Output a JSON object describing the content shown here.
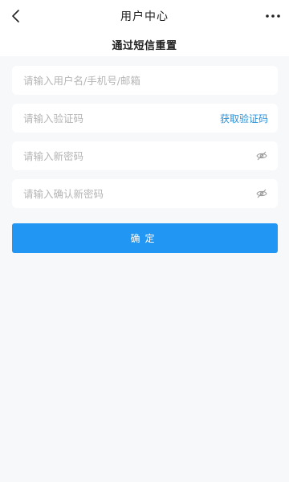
{
  "navbar": {
    "title": "用户中心",
    "back_icon": "chevron-left-icon",
    "more_icon": "more-horizontal-icon"
  },
  "subheader": {
    "title": "通过短信重置"
  },
  "form": {
    "username_placeholder": "请输入用户名/手机号/邮箱",
    "code_placeholder": "请输入验证码",
    "get_code_label": "获取验证码",
    "new_password_placeholder": "请输入新密码",
    "confirm_password_placeholder": "请输入确认新密码",
    "eye_icon": "eye-off-icon"
  },
  "confirm_button": {
    "label": "确定"
  },
  "colors": {
    "accent": "#2196f3",
    "link": "#2a8fd6",
    "background": "#f7f8fa"
  }
}
